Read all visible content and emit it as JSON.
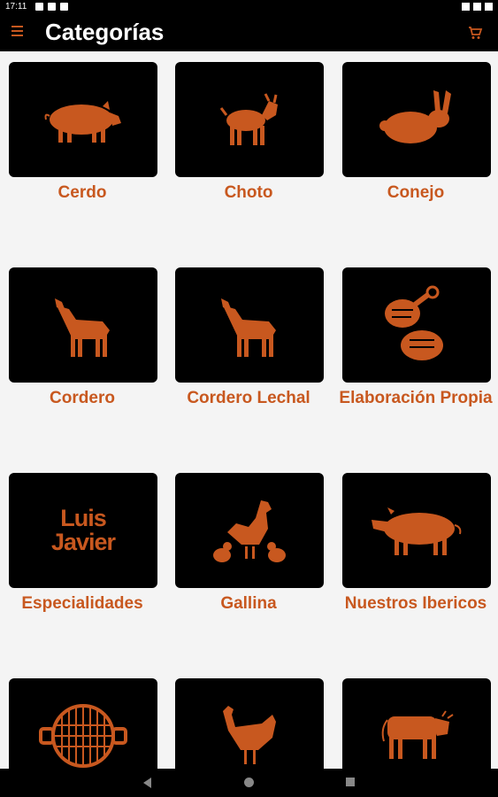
{
  "status_bar": {
    "time": "17:11"
  },
  "app_bar": {
    "title": "Categorías",
    "menu_icon": "menu-icon",
    "cart_icon": "cart-icon"
  },
  "theme": {
    "accent": "#c8581f",
    "card_bg": "#000000",
    "page_bg": "#f4f4f4"
  },
  "categories": [
    {
      "label": "Cerdo",
      "icon": "pig-icon"
    },
    {
      "label": "Choto",
      "icon": "goat-icon"
    },
    {
      "label": "Conejo",
      "icon": "rabbit-icon"
    },
    {
      "label": "Cordero",
      "icon": "lamb-icon"
    },
    {
      "label": "Cordero Lechal",
      "icon": "lamb-icon"
    },
    {
      "label": "Elaboración Propia",
      "icon": "meat-cuts-icon"
    },
    {
      "label": "Especialidades",
      "icon": "luis-javier-logo",
      "logo_text": [
        "Luis",
        "Javier"
      ]
    },
    {
      "label": "Gallina",
      "icon": "hen-chicks-icon"
    },
    {
      "label": "Nuestros Ibericos",
      "icon": "iberian-pig-icon"
    },
    {
      "label": "",
      "icon": "grill-icon"
    },
    {
      "label": "",
      "icon": "chicken-icon"
    },
    {
      "label": "",
      "icon": "cow-icon"
    }
  ]
}
